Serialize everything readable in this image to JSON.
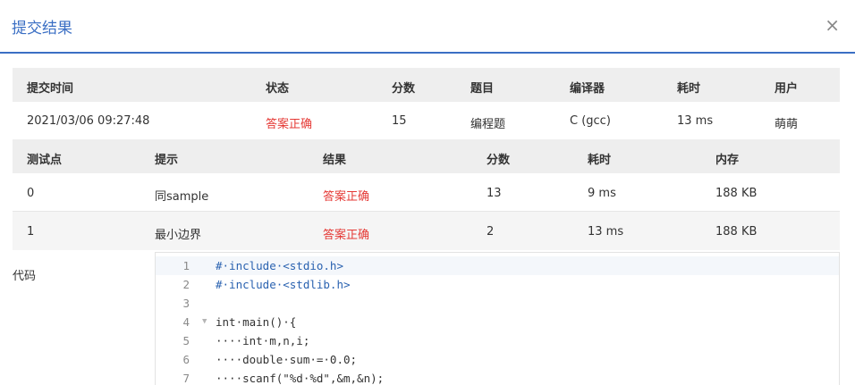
{
  "dialog": {
    "title": "提交结果",
    "close_glyph": "×"
  },
  "summary": {
    "headers": [
      "提交时间",
      "状态",
      "分数",
      "题目",
      "编译器",
      "耗时",
      "用户"
    ],
    "row": [
      "2021/03/06 09:27:48",
      "答案正确",
      "15",
      "编程题",
      "C (gcc)",
      "13 ms",
      "萌萌"
    ]
  },
  "cases": {
    "headers": [
      "测试点",
      "提示",
      "结果",
      "分数",
      "耗时",
      "内存"
    ],
    "rows": [
      [
        "0",
        "同sample",
        "答案正确",
        "13",
        "9 ms",
        "188 KB"
      ],
      [
        "1",
        "最小边界",
        "答案正确",
        "2",
        "13 ms",
        "188 KB"
      ]
    ]
  },
  "code": {
    "label": "代码",
    "lines": [
      {
        "n": "1",
        "text": "#·include·<stdio.h>"
      },
      {
        "n": "2",
        "text": "#·include·<stdlib.h>"
      },
      {
        "n": "3",
        "text": ""
      },
      {
        "n": "4",
        "text": "int·main()·{"
      },
      {
        "n": "5",
        "text": "····int·m,n,i;"
      },
      {
        "n": "6",
        "text": "····double·sum·=·0.0;"
      },
      {
        "n": "7",
        "text": "····scanf(\"%d·%d\",&m,&n);"
      }
    ]
  },
  "colors": {
    "accent": "#3b6fc4",
    "accepted": "#e53935",
    "header_bg": "#eeeeee"
  }
}
